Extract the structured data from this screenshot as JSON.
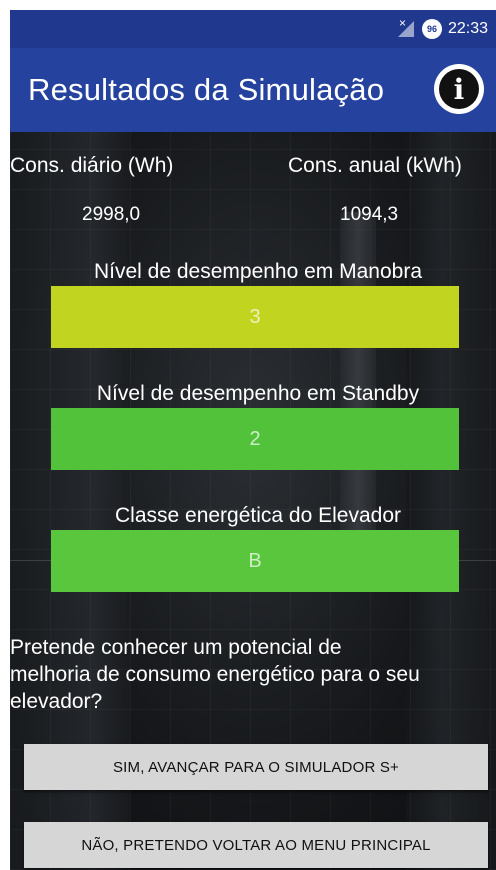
{
  "status_bar": {
    "time": "22:33",
    "battery_level": "96",
    "icons": [
      "no-signal-icon",
      "battery-icon"
    ]
  },
  "app_bar": {
    "title": "Resultados da Simulação",
    "info_icon": "info-icon"
  },
  "consumption": {
    "daily_label": "Cons. diário (Wh)",
    "daily_value": "2998,0",
    "annual_label": "Cons. anual (kWh)",
    "annual_value": "1094,3"
  },
  "levels": [
    {
      "label": "Nível de desempenho em Manobra",
      "value": "3",
      "color": "#c1d420"
    },
    {
      "label": "Nível de desempenho em Standby",
      "value": "2",
      "color": "#52c23a"
    },
    {
      "label": "Classe energética do Elevador",
      "value": "B",
      "color": "#5ac63d"
    }
  ],
  "question": {
    "line1": "Pretende conhecer um potencial de",
    "line2": "melhoria de consumo energético para o seu",
    "line3": "elevador?"
  },
  "buttons": {
    "yes_label": "SIM, AVANÇAR PARA O SIMULADOR S+",
    "no_label": "NÃO, PRETENDO VOLTAR AO MENU PRINCIPAL"
  },
  "colors": {
    "status_bar": "#21388f",
    "app_bar": "#25429e",
    "button_bg": "#d6d6d6"
  }
}
